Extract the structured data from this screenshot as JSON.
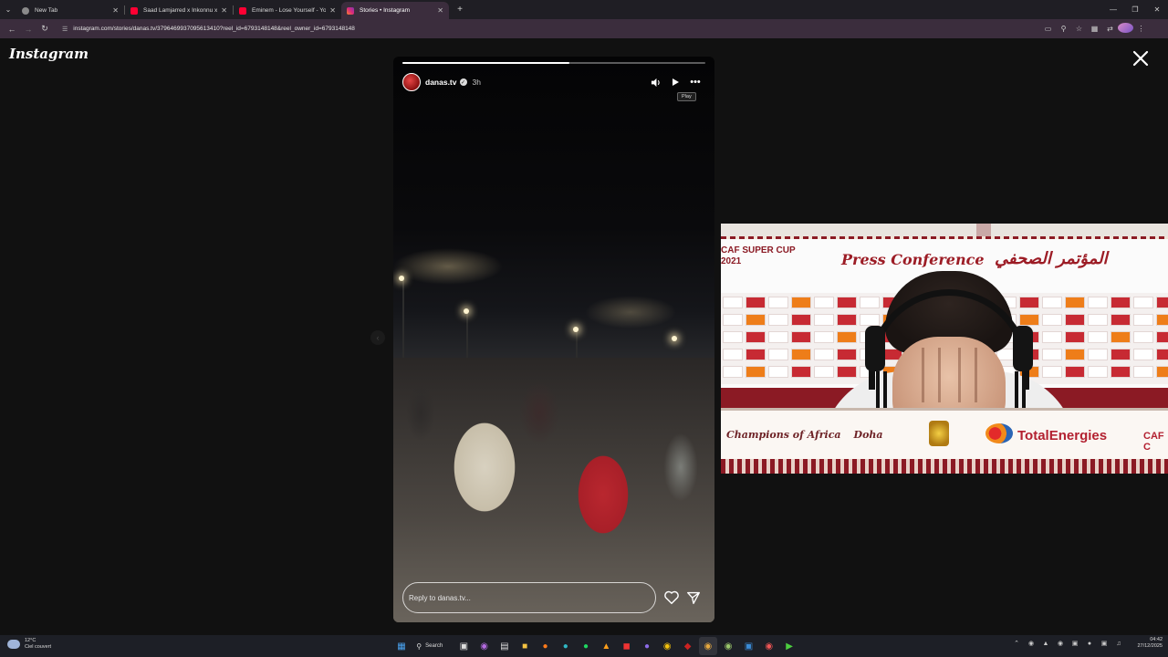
{
  "browser": {
    "tabs": [
      {
        "title": "New Tab",
        "active": false,
        "favicon_color": "#8a8a8a"
      },
      {
        "title": "Saad Lamjarred x Inkonnu x Af…",
        "active": false,
        "favicon_color": "#ff0033"
      },
      {
        "title": "Eminem - Lose Yourself - YouTu…",
        "active": false,
        "favicon_color": "#ff0033"
      },
      {
        "title": "Stories • Instagram",
        "active": true,
        "favicon_color": "#e1306c"
      }
    ],
    "url": "instagram.com/stories/danas.tv/3796469937095613410?reel_id=6793148148&reel_owner_id=6793148148"
  },
  "instagram": {
    "logo": "Instagram",
    "story": {
      "username": "danas.tv",
      "time_ago": "3h",
      "progress": 0.55,
      "tooltip": "Play",
      "reply_placeholder": "Reply to danas.tv..."
    }
  },
  "overlay": {
    "super_cup_line1": "CAF SUPER CUP",
    "super_cup_line2": "2021",
    "title": "Press Conference",
    "title_arabic": "المؤتمر الصحفي",
    "champions": "Champions of Africa",
    "city": "Doha",
    "sponsor": "TotalEnergies",
    "caf": "CAF C"
  },
  "taskbar": {
    "temperature": "12°C",
    "weather": "Ciel couvert",
    "search": "Search",
    "time": "04:42",
    "date": "27/12/2025"
  }
}
